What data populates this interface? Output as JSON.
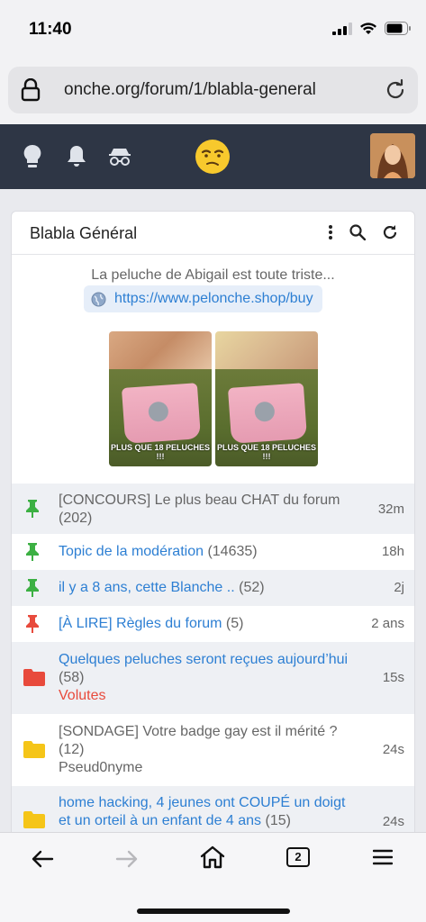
{
  "status_bar": {
    "time": "11:40"
  },
  "browser": {
    "url": "onche.org/forum/1/blabla-general",
    "tab_count": "2"
  },
  "forum": {
    "title": "Blabla Général",
    "promo_text": "La peluche de Abigail est toute triste...",
    "promo_link": "https://www.pelonche.shop/buy",
    "ad_caption": "PLUS QUE 18 PELUCHES !!!"
  },
  "topics": [
    {
      "title": "[CONCOURS] Le plus beau CHAT du forum",
      "count": "(202)",
      "time": "32m",
      "icon": "pin-green-icon",
      "link": false,
      "author": ""
    },
    {
      "title": "Topic de la modération",
      "count": "(14635)",
      "time": "18h",
      "icon": "pin-green-icon",
      "link": true,
      "author": ""
    },
    {
      "title": "il y a 8 ans, cette Blanche ..",
      "count": "(52)",
      "time": "2j",
      "icon": "pin-green-icon",
      "link": true,
      "author": ""
    },
    {
      "title": "[À LIRE] Règles du forum",
      "count": "(5)",
      "time": "2 ans",
      "icon": "pin-red-icon",
      "link": true,
      "author": ""
    },
    {
      "title": "Quelques peluches seront reçues aujourd’hui",
      "count": "(58)",
      "time": "15s",
      "icon": "folder-red-icon",
      "link": true,
      "author": "Volutes"
    },
    {
      "title": "[SONDAGE] Votre badge gay est il mérité ?",
      "count": "(12)",
      "time": "24s",
      "icon": "folder-yellow-icon",
      "link": false,
      "author": "Pseud0nyme"
    },
    {
      "title": "home hacking, 4 jeunes ont COUPÉ un doigt et un orteil à un enfant de 4 ans",
      "count": "(15)",
      "time": "24s",
      "icon": "folder-yellow-icon",
      "link": true,
      "author": ""
    }
  ],
  "colors": {
    "header_bg": "#2e3645",
    "link": "#2d7fd3",
    "pin_green": "#3cb043",
    "pin_red": "#e84a3c",
    "folder_red": "#e84a3c",
    "folder_yellow": "#f5c518",
    "author_red": "#e84a3c"
  }
}
